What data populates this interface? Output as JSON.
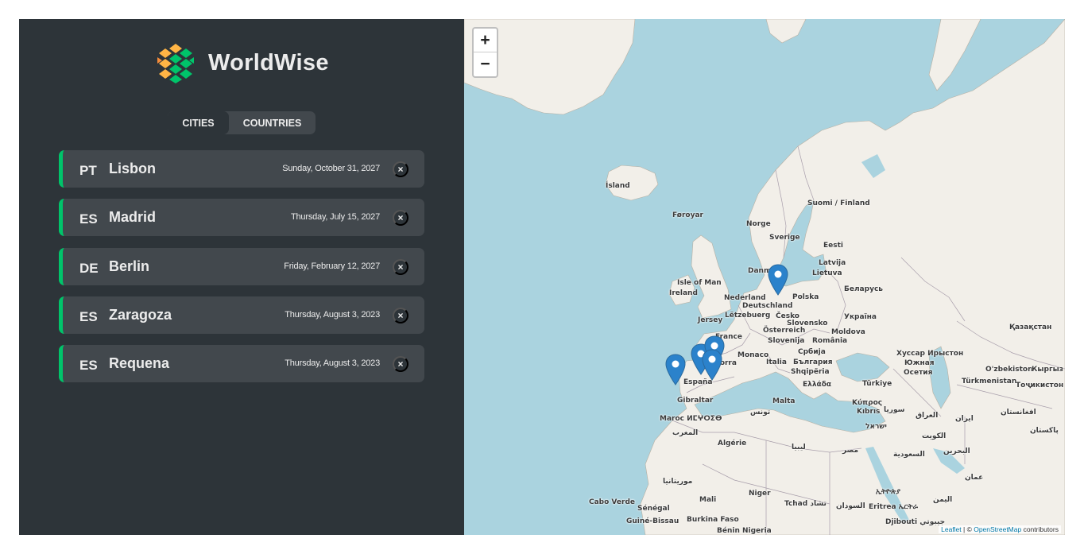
{
  "app": {
    "name": "WorldWise"
  },
  "tabs": {
    "cities": "Cities",
    "countries": "Countries"
  },
  "cities": [
    {
      "flag": "PT",
      "name": "Lisbon",
      "date": "Sunday, October 31, 2027"
    },
    {
      "flag": "ES",
      "name": "Madrid",
      "date": "Thursday, July 15, 2027"
    },
    {
      "flag": "DE",
      "name": "Berlin",
      "date": "Friday, February 12, 2027"
    },
    {
      "flag": "ES",
      "name": "Zaragoza",
      "date": "Thursday, August 3, 2023"
    },
    {
      "flag": "ES",
      "name": "Requena",
      "date": "Thursday, August 3, 2023"
    }
  ],
  "delete_symbol": "×",
  "map": {
    "zoom_in": "+",
    "zoom_out": "−",
    "labels": {
      "island": "Ísland",
      "foroyar": "Føroyar",
      "norge": "Norge",
      "sverige": "Sverige",
      "suomi": "Suomi / Finland",
      "eesti": "Eesti",
      "latvija": "Latvija",
      "lietuva": "Lietuva",
      "belarus": "Беларусь",
      "danmark": "Danm",
      "isle_of_man": "Isle of Man",
      "ireland": "Ireland",
      "nederland": "Nederland",
      "deutschland": "Deutschland",
      "polska": "Polska",
      "letzebuerg": "Lëtzebuerg",
      "jersey": "Jersey",
      "cesko": "Česko",
      "slovensko": "Slovensko",
      "ukraina": "Україна",
      "france": "France",
      "osterreich": "Österreich",
      "moldova": "Moldova",
      "slovenija": "Slovenija",
      "romania": "România",
      "srbija": "Србија",
      "monaco": "Monaco",
      "andorra": "Andorra",
      "italia": "Italia",
      "bulgaria": "България",
      "shqiperia": "Shqipëria",
      "ellada": "Ελλάδα",
      "espana": "España",
      "turkiye": "Türkiye",
      "gibraltar": "Gibraltar",
      "malta": "Malta",
      "kypros": "Κύπρος",
      "kibris": "Kıbrıs",
      "maroc": "Maroc ⵍⵎⵖⵔⵉⴱ",
      "tunes": "تونس",
      "suriya": "سوريا",
      "iraq": "العراق",
      "iran": "ایران",
      "afghanistan": "افغانستان",
      "pakistan": "پاکستان",
      "maghrib": "المغرب",
      "israel": "ישראל",
      "kuwait": "الكويت",
      "algerie": "Algérie",
      "libya": "ليبيا",
      "misr": "مصر",
      "saudia": "السعودية",
      "bahrain": "البحرين",
      "kazakhstan": "Қазақстан",
      "ozbekiston": "O'zbekiston",
      "kyrgyz": "Кыргыз",
      "turkmenistan": "Türkmenistan",
      "tojikiston": "Тоҷикистон",
      "khassar": "Хуссар Ирыстон",
      "yuzhnaya": "Южная",
      "osetiya": "Осетия",
      "mauritania": "موريتانيا",
      "mali": "Mali",
      "niger": "Niger",
      "tchad": "Tchad تشاد",
      "sudan": "السودان",
      "eritrea": "Eritrea ኤርትራ",
      "ethiopia": "ኢትዮጵያ",
      "yemen": "اليمن",
      "oman": "عمان",
      "cabo_verde": "Cabo Verde",
      "senegal": "Sénégal",
      "guinea_bissau": "Guiné-Bissau",
      "burkina": "Burkina Faso",
      "djibouti": "Djibouti جيبوتي",
      "benin": "Bénin Nigeria"
    },
    "attribution": {
      "leaflet": "Leaflet",
      "sep": " | © ",
      "osm": "OpenStreetMap",
      "contrib": " contributors"
    }
  },
  "colors": {
    "sidebar": "#2d3439",
    "item": "#42484d",
    "accent": "#00c46a",
    "text": "#ececec",
    "water": "#aad3df",
    "land": "#f2efe9",
    "marker": "#2b82cb"
  }
}
